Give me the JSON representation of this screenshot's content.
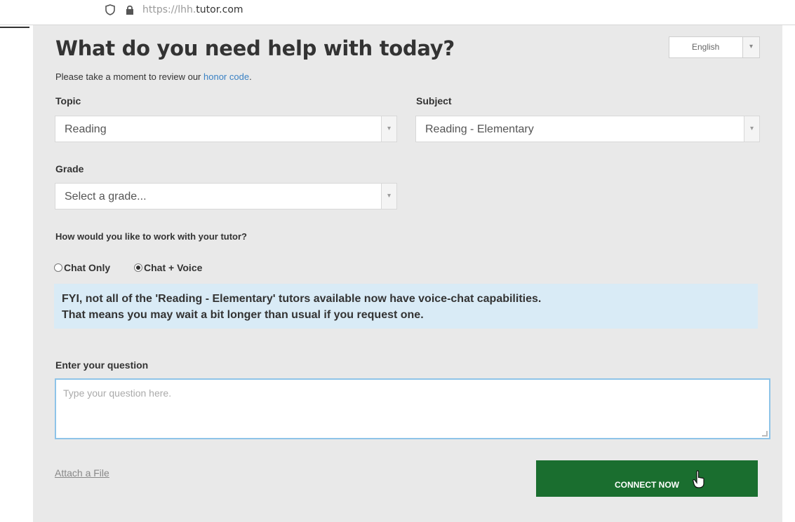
{
  "browser": {
    "url_prefix": "https://",
    "url_host_dim": "lhh.",
    "url_host_main": "tutor.com",
    "shield_icon": "shield-icon",
    "lock_icon": "lock-icon"
  },
  "header": {
    "title": "What do you need help with today?",
    "language": "English"
  },
  "honor": {
    "text": "Please take a moment to review our ",
    "link": "honor code",
    "suffix": "."
  },
  "form": {
    "topic_label": "Topic",
    "topic_value": "Reading",
    "subject_label": "Subject",
    "subject_value": "Reading - Elementary",
    "grade_label": "Grade",
    "grade_value": "Select a grade...",
    "work_label": "How would you like to work with your tutor?",
    "options": [
      {
        "label": "Chat Only",
        "selected": false
      },
      {
        "label": "Chat + Voice",
        "selected": true
      }
    ],
    "fyi_line1": "FYI, not all of the 'Reading - Elementary' tutors available now have voice-chat capabilities.",
    "fyi_line2": "That means you may wait a bit longer than usual if you request one.",
    "question_label": "Enter your question",
    "question_placeholder": "Type your question here.",
    "attach_label": "Attach a File",
    "connect_label": "CONNECT NOW"
  },
  "colors": {
    "connect_button": "#1a6e2f",
    "info_box": "#d9ebf6",
    "link": "#3b82c4"
  }
}
